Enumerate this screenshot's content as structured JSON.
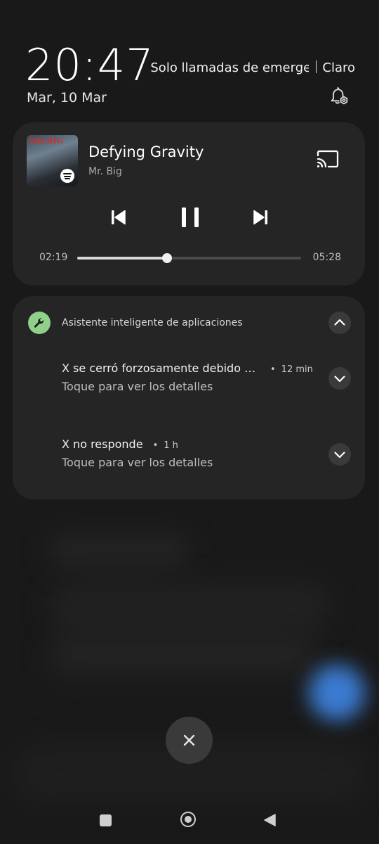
{
  "status": {
    "time": "20:47",
    "date": "Mar, 10 Mar",
    "network_status": "Solo llamadas de emergencia",
    "carrier": "Claro",
    "settings_icon": "notification-settings-icon"
  },
  "media": {
    "album_art_text": "MR.BIG",
    "title": "Defying Gravity",
    "artist": "Mr. Big",
    "elapsed": "02:19",
    "duration": "05:28",
    "progress": 0.4,
    "icons": {
      "cast": "cast-icon",
      "previous": "skip-previous-icon",
      "pause": "pause-icon",
      "next": "skip-next-icon",
      "spotify": "spotify-icon"
    }
  },
  "notifications": {
    "app_name": "Asistente inteligente de aplicaciones",
    "app_icon": "wrench-icon",
    "app_icon_color": "#8fd08a",
    "items": [
      {
        "title": "X se cerró forzosamente debido a una excepción",
        "time": "12 min",
        "detail": "Toque para ver los detalles"
      },
      {
        "title": "X no responde",
        "time": "1 h",
        "detail": "Toque para ver los detalles"
      }
    ]
  },
  "clear_all": {
    "icon": "close-icon"
  },
  "navigation": {
    "recents": "recents-icon",
    "home": "home-icon",
    "back": "back-icon"
  }
}
